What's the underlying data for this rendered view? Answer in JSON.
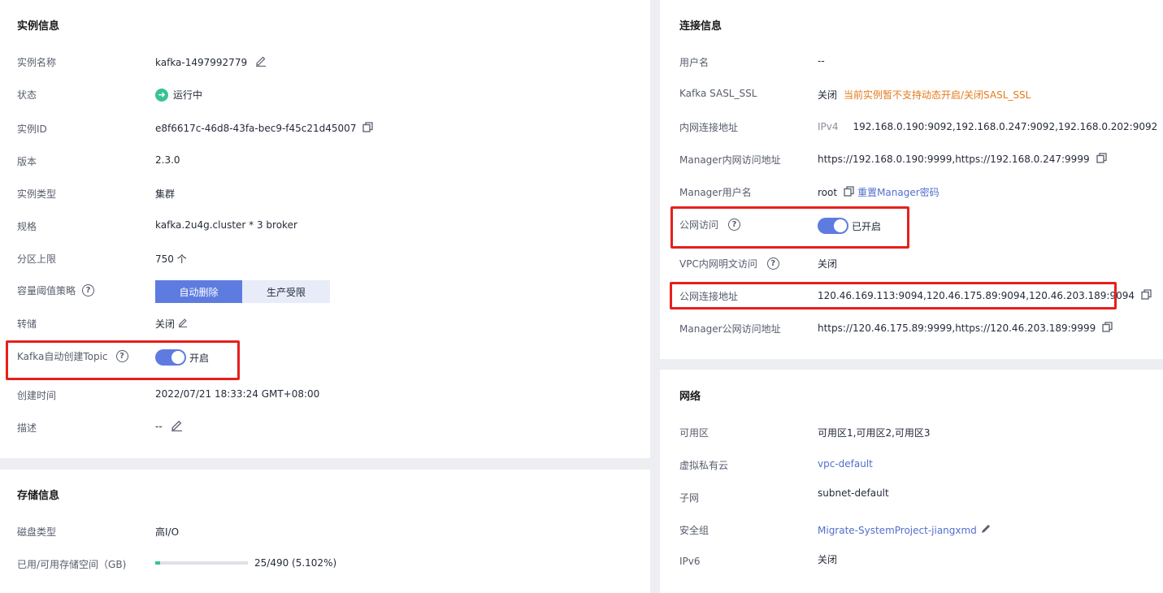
{
  "instance_info": {
    "title": "实例信息",
    "name_label": "实例名称",
    "name_value": "kafka-1497992779",
    "status_label": "状态",
    "status_value": "运行中",
    "id_label": "实例ID",
    "id_value": "e8f6617c-46d8-43fa-bec9-f45c21d45007",
    "version_label": "版本",
    "version_value": "2.3.0",
    "type_label": "实例类型",
    "type_value": "集群",
    "spec_label": "规格",
    "spec_value": "kafka.2u4g.cluster * 3 broker",
    "partition_label": "分区上限",
    "partition_value": "750 个",
    "threshold_label": "容量阈值策略",
    "threshold_option_1": "自动删除",
    "threshold_option_2": "生产受限",
    "threshold_selected": "自动删除",
    "dump_label": "转储",
    "dump_value": "关闭",
    "auto_topic_label": "Kafka自动创建Topic",
    "auto_topic_value": "开启",
    "created_label": "创建时间",
    "created_value": "2022/07/21 18:33:24 GMT+08:00",
    "desc_label": "描述",
    "desc_value": "--"
  },
  "storage_info": {
    "title": "存储信息",
    "disk_label": "磁盘类型",
    "disk_value": "高I/O",
    "usage_label": "已用/可用存储空间（GB)",
    "usage_value": "25/490 (5.102%)",
    "usage_fraction": 0.05102
  },
  "connection_info": {
    "title": "连接信息",
    "user_label": "用户名",
    "user_value": "--",
    "sasl_label": "Kafka SASL_SSL",
    "sasl_value": "关闭",
    "sasl_note": "当前实例暂不支持动态开启/关闭SASL_SSL",
    "intranet_label": "内网连接地址",
    "intranet_proto": "IPv4",
    "intranet_value": "192.168.0.190:9092,192.168.0.247:9092,192.168.0.202:9092",
    "mgr_intranet_label": "Manager内网访问地址",
    "mgr_intranet_value": "https://192.168.0.190:9999,https://192.168.0.247:9999",
    "mgr_user_label": "Manager用户名",
    "mgr_user_value": "root",
    "mgr_reset_link": "重置Manager密码",
    "public_label": "公网访问",
    "public_value": "已开启",
    "vpc_plain_label": "VPC内网明文访问",
    "vpc_plain_value": "关闭",
    "public_addr_label": "公网连接地址",
    "public_addr_value": "120.46.169.113:9094,120.46.175.89:9094,120.46.203.189:9094",
    "mgr_public_label": "Manager公网访问地址",
    "mgr_public_value": "https://120.46.175.89:9999,https://120.46.203.189:9999"
  },
  "network": {
    "title": "网络",
    "az_label": "可用区",
    "az_value": "可用区1,可用区2,可用区3",
    "vpc_label": "虚拟私有云",
    "vpc_value": "vpc-default",
    "subnet_label": "子网",
    "subnet_value": "subnet-default",
    "sg_label": "安全组",
    "sg_value": "Migrate-SystemProject-jiangxmd",
    "ipv6_label": "IPv6",
    "ipv6_value": "关闭"
  },
  "colors": {
    "accent": "#5e7ce0",
    "link": "#526ecc",
    "warning": "#e37b1b",
    "success": "#3ac295",
    "highlight": "#e5201d"
  }
}
